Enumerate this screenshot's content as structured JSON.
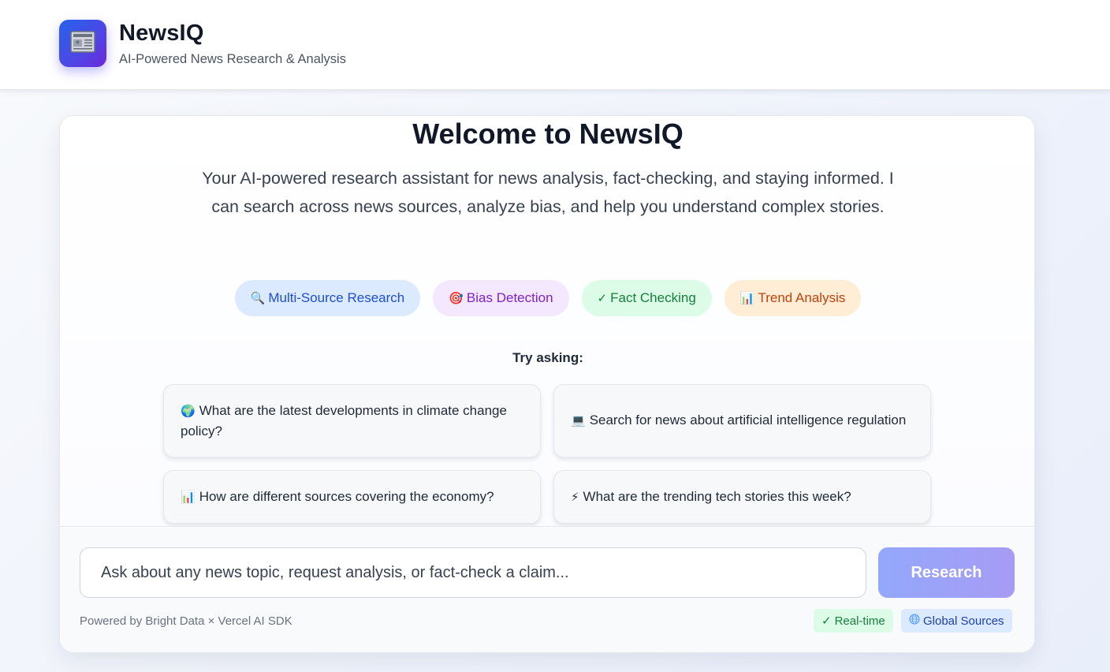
{
  "header": {
    "title": "NewsIQ",
    "subtitle": "AI-Powered News Research & Analysis",
    "logo_icon": "newspaper-icon"
  },
  "welcome": {
    "title": "Welcome to NewsIQ",
    "description": "Your AI-powered research assistant for news analysis, fact-checking, and staying informed. I can search across news sources, analyze bias, and help you understand complex stories."
  },
  "features": [
    {
      "icon": "🔍",
      "label": "Multi-Source Research",
      "color": "#1d4ed8"
    },
    {
      "icon": "🎯",
      "label": "Bias Detection",
      "color": "#7e22ce"
    },
    {
      "icon": "✓",
      "label": "Fact Checking",
      "color": "#15803d"
    },
    {
      "icon": "📊",
      "label": "Trend Analysis",
      "color": "#c2410c"
    }
  ],
  "try_asking": {
    "label": "Try asking:",
    "suggestions": [
      {
        "icon": "🌍",
        "text": "What are the latest developments in climate change policy?"
      },
      {
        "icon": "💻",
        "text": "Search for news about artificial intelligence regulation"
      },
      {
        "icon": "📊",
        "text": "How are different sources covering the economy?"
      },
      {
        "icon": "⚡",
        "text": "What are the trending tech stories this week?"
      }
    ]
  },
  "composer": {
    "placeholder": "Ask about any news topic, request analysis, or fact-check a claim...",
    "value": "",
    "submit_label": "Research",
    "powered_by": "Powered by Bright Data × Vercel AI SDK",
    "badges": [
      {
        "icon": "✓",
        "label": "Real-time"
      },
      {
        "icon": "🌐",
        "label": "Global Sources"
      }
    ]
  },
  "colors": {
    "brand_gradient_start": "#2563eb",
    "brand_gradient_end": "#6d28d9",
    "button_start": "#93a8fb",
    "button_end": "#a79bf5"
  }
}
